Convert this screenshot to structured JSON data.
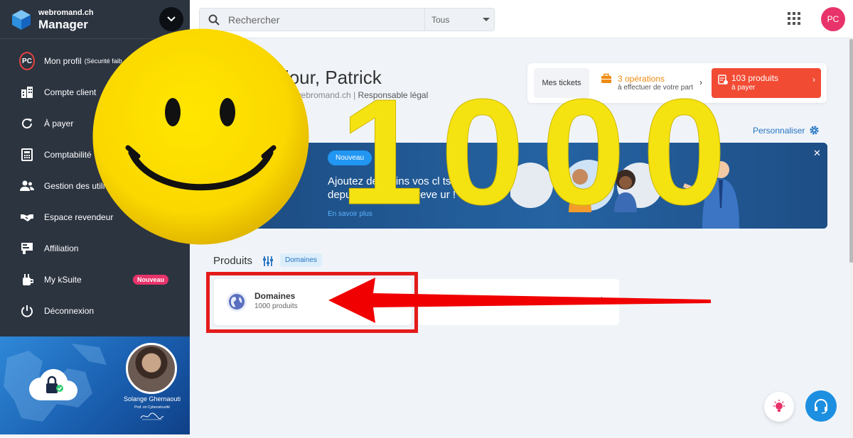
{
  "brand": {
    "subtitle": "webromand.ch",
    "title": "Manager"
  },
  "sidebar": {
    "profile": {
      "initials": "PC",
      "label": "Mon profil",
      "note": "(Sécurité faib"
    },
    "items": [
      {
        "label": "Compte client",
        "icon": "building-icon"
      },
      {
        "label": "À payer",
        "icon": "refresh-icon"
      },
      {
        "label": "Comptabilité",
        "icon": "calculator-icon"
      },
      {
        "label": "Gestion des utili",
        "icon": "users-icon"
      },
      {
        "label": "Espace revendeur",
        "icon": "handshake-icon"
      },
      {
        "label": "Affiliation",
        "icon": "affiliation-icon"
      },
      {
        "label": "My kSuite",
        "icon": "ksuite-icon",
        "badge": "Nouveau"
      },
      {
        "label": "Déconnexion",
        "icon": "power-icon"
      }
    ],
    "promo": {
      "name": "Solange Ghernaouti",
      "title": "Prof. en Cybersécurité"
    }
  },
  "search": {
    "placeholder": "Rechercher",
    "scope": "Tous"
  },
  "topbar": {
    "avatar_initials": "PC"
  },
  "greeting": {
    "prefix": "onjour,",
    "name": "Patrick",
    "domain": "webromand.ch",
    "separator": "|",
    "role": "Responsable légal"
  },
  "header_cards": {
    "tickets": "Mes tickets",
    "operations": {
      "count": "3 opérations",
      "note": "à effectuer de votre part"
    },
    "pay": {
      "count": "103 produits",
      "note": "à payer"
    }
  },
  "personnaliser": "Personnaliser",
  "banner": {
    "badge": "Nouveau",
    "line1": "Ajoutez dé   mains vos cl   ts",
    "line2": "depuis vot   espace reve    ur !",
    "link": "En savoir plus"
  },
  "products": {
    "title": "Produits",
    "chip": "Domaines",
    "card1": {
      "name": "Domaines",
      "count": "1000 produits"
    }
  },
  "overlay": {
    "number": "1000"
  },
  "colors": {
    "sidebar": "#2c3440",
    "accent": "#2474c2",
    "pink": "#e8336a",
    "orange": "#f08b12",
    "red": "#f24b34",
    "yellow": "#f5e211"
  }
}
